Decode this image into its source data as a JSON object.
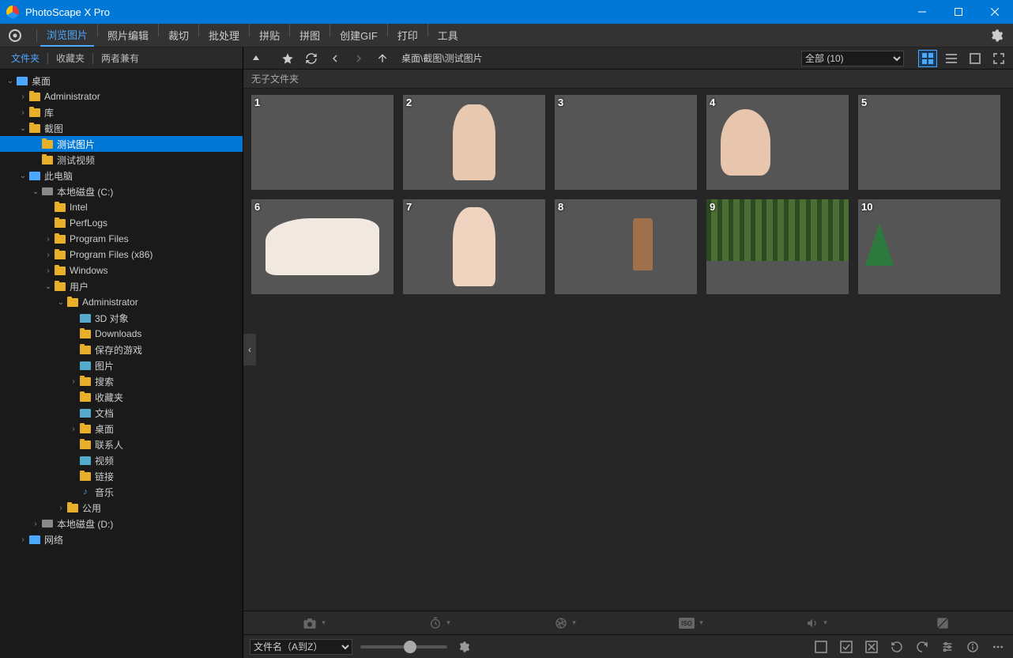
{
  "titlebar": {
    "title": "PhotoScape X Pro"
  },
  "mainmenu": {
    "items": [
      "浏览图片",
      "照片编辑",
      "裁切",
      "批处理",
      "拼贴",
      "拼图",
      "创建GIF",
      "打印",
      "工具"
    ],
    "activeIndex": 0
  },
  "sidebarTabs": {
    "items": [
      "文件夹",
      "收藏夹",
      "两者兼有"
    ],
    "activeIndex": 0
  },
  "tree": [
    {
      "depth": 0,
      "expand": "down",
      "icon": "pc",
      "label": "桌面"
    },
    {
      "depth": 1,
      "expand": "right",
      "icon": "folder",
      "label": "Administrator"
    },
    {
      "depth": 1,
      "expand": "right",
      "icon": "folder",
      "label": "库"
    },
    {
      "depth": 1,
      "expand": "down",
      "icon": "folder",
      "label": "截图"
    },
    {
      "depth": 2,
      "expand": "none",
      "icon": "folder",
      "label": "测试图片",
      "selected": true
    },
    {
      "depth": 2,
      "expand": "none",
      "icon": "folder",
      "label": "测试视频"
    },
    {
      "depth": 1,
      "expand": "down",
      "icon": "pc",
      "label": "此电脑"
    },
    {
      "depth": 2,
      "expand": "down",
      "icon": "drive",
      "label": "本地磁盘 (C:)"
    },
    {
      "depth": 3,
      "expand": "none",
      "icon": "folder",
      "label": "Intel"
    },
    {
      "depth": 3,
      "expand": "none",
      "icon": "folder",
      "label": "PerfLogs"
    },
    {
      "depth": 3,
      "expand": "right",
      "icon": "folder",
      "label": "Program Files"
    },
    {
      "depth": 3,
      "expand": "right",
      "icon": "folder",
      "label": "Program Files (x86)"
    },
    {
      "depth": 3,
      "expand": "right",
      "icon": "folder",
      "label": "Windows"
    },
    {
      "depth": 3,
      "expand": "down",
      "icon": "folder",
      "label": "用户"
    },
    {
      "depth": 4,
      "expand": "down",
      "icon": "folder",
      "label": "Administrator"
    },
    {
      "depth": 5,
      "expand": "none",
      "icon": "img",
      "label": "3D 对象"
    },
    {
      "depth": 5,
      "expand": "none",
      "icon": "folder",
      "label": "Downloads"
    },
    {
      "depth": 5,
      "expand": "none",
      "icon": "folder",
      "label": "保存的游戏"
    },
    {
      "depth": 5,
      "expand": "none",
      "icon": "img",
      "label": "图片"
    },
    {
      "depth": 5,
      "expand": "right",
      "icon": "folder",
      "label": "搜索"
    },
    {
      "depth": 5,
      "expand": "none",
      "icon": "folder",
      "label": "收藏夹"
    },
    {
      "depth": 5,
      "expand": "none",
      "icon": "img",
      "label": "文档"
    },
    {
      "depth": 5,
      "expand": "right",
      "icon": "folder",
      "label": "桌面"
    },
    {
      "depth": 5,
      "expand": "none",
      "icon": "folder",
      "label": "联系人"
    },
    {
      "depth": 5,
      "expand": "none",
      "icon": "img",
      "label": "视频"
    },
    {
      "depth": 5,
      "expand": "none",
      "icon": "folder",
      "label": "链接"
    },
    {
      "depth": 5,
      "expand": "none",
      "icon": "music",
      "label": "音乐"
    },
    {
      "depth": 4,
      "expand": "right",
      "icon": "folder",
      "label": "公用"
    },
    {
      "depth": 2,
      "expand": "right",
      "icon": "drive",
      "label": "本地磁盘 (D:)"
    },
    {
      "depth": 1,
      "expand": "right",
      "icon": "pc",
      "label": "网络"
    }
  ],
  "toolbar": {
    "breadcrumb": "桌面\\截图\\测试图片",
    "filterSelect": "全部 (10)"
  },
  "subbar": {
    "text": "无子文件夹"
  },
  "thumbnails": [
    {
      "num": "1",
      "cls": "ph-portrait1"
    },
    {
      "num": "2",
      "cls": "ph-portrait2"
    },
    {
      "num": "3",
      "cls": "ph-portrait3"
    },
    {
      "num": "4",
      "cls": "ph-portrait4"
    },
    {
      "num": "5",
      "cls": "ph-portrait5"
    },
    {
      "num": "6",
      "cls": "ph-portrait6"
    },
    {
      "num": "7",
      "cls": "ph-portrait7"
    },
    {
      "num": "8",
      "cls": "ph-rock"
    },
    {
      "num": "9",
      "cls": "ph-forest"
    },
    {
      "num": "10",
      "cls": "ph-beach"
    }
  ],
  "botbar2": {
    "sortSelect": "文件名（A到Z）"
  }
}
